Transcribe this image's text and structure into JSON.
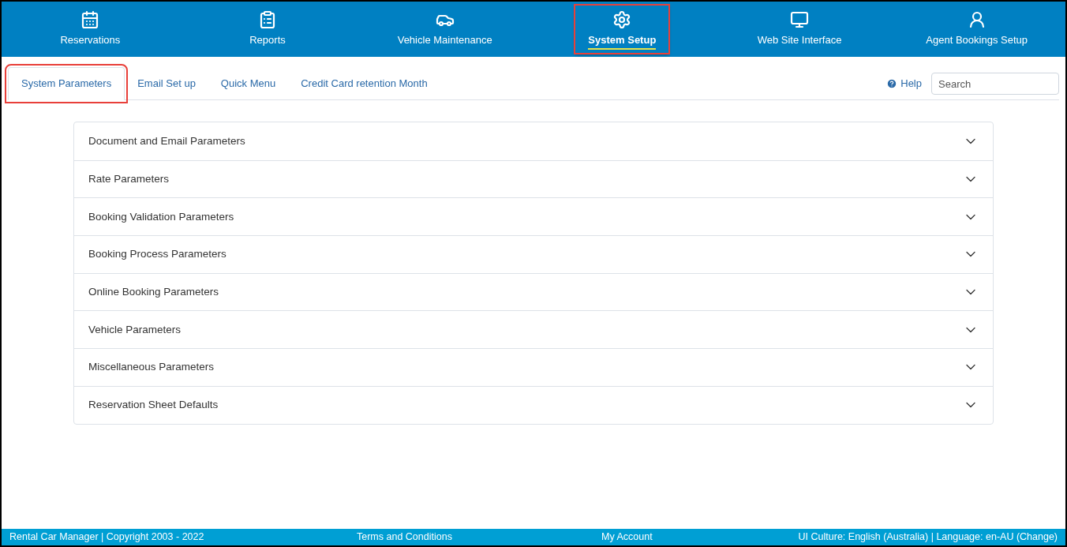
{
  "nav": [
    {
      "label": "Reservations",
      "selected": false
    },
    {
      "label": "Reports",
      "selected": false
    },
    {
      "label": "Vehicle Maintenance",
      "selected": false
    },
    {
      "label": "System Setup",
      "selected": true
    },
    {
      "label": "Web Site Interface",
      "selected": false
    },
    {
      "label": "Agent Bookings Setup",
      "selected": false
    }
  ],
  "tabs": [
    {
      "label": "System Parameters",
      "selected": true
    },
    {
      "label": "Email Set up",
      "selected": false
    },
    {
      "label": "Quick Menu",
      "selected": false
    },
    {
      "label": "Credit Card retention Month",
      "selected": false
    }
  ],
  "help": "Help",
  "search": {
    "placeholder": "Search"
  },
  "sections": [
    {
      "title": "Document and Email Parameters",
      "expanded": false
    },
    {
      "title": "Rate Parameters",
      "expanded": false
    },
    {
      "title": "Booking Validation Parameters",
      "expanded": false
    },
    {
      "title": "Booking Process Parameters",
      "expanded": false
    },
    {
      "title": "Online Booking Parameters",
      "expanded": false
    },
    {
      "title": "Vehicle Parameters",
      "expanded": false
    },
    {
      "title": "Miscellaneous Parameters",
      "expanded": false
    },
    {
      "title": "Reservation Sheet Defaults",
      "expanded": false
    }
  ],
  "footer": {
    "copyright": "Rental Car Manager | Copyright 2003 - 2022",
    "terms": "Terms and Conditions",
    "account": "My Account",
    "culture": "UI Culture: English (Australia) | Language: en-AU (Change)"
  }
}
